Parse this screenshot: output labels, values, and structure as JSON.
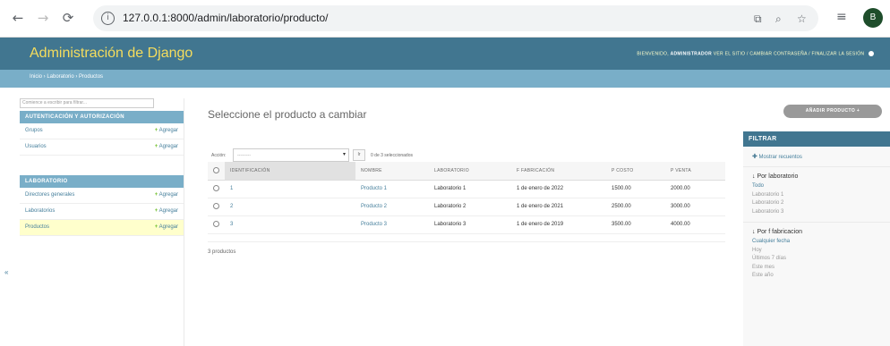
{
  "browser": {
    "back": "←",
    "forward": "→",
    "reload": "⟳",
    "url": "127.0.0.1:8000/admin/laboratorio/producto/",
    "profile_initial": "B"
  },
  "header": {
    "brand": "Administración de Django",
    "welcome": "BIENVENIDO,",
    "user": "ADMINISTRADOR",
    "links": "VER EL SITIO / CAMBIAR CONTRASEÑA / FINALIZAR LA SESIÓN"
  },
  "breadcrumbs": "Inicio › Laboratorio › Productos",
  "sidebar": {
    "filter_placeholder": "Comience a escribir para filtrar...",
    "apps": [
      {
        "caption": "AUTENTICACIÓN Y AUTORIZACIÓN",
        "models": [
          {
            "name": "Grupos",
            "add": "Agregar"
          },
          {
            "name": "Usuarios",
            "add": "Agregar"
          }
        ]
      },
      {
        "caption": "LABORATORIO",
        "models": [
          {
            "name": "Directores generales",
            "add": "Agregar"
          },
          {
            "name": "Laboratorios",
            "add": "Agregar"
          },
          {
            "name": "Productos",
            "add": "Agregar"
          }
        ]
      }
    ],
    "collapse": "«"
  },
  "main": {
    "title": "Seleccione el producto a cambiar",
    "add_button": "AÑADIR PRODUCTO +",
    "action_label": "Acción:",
    "action_select": "---------",
    "go_button": "Ir",
    "selected_count": "0 de 3 seleccionados",
    "columns": [
      "IDENTIFICACIÓN",
      "NOMBRE",
      "LABORATORIO",
      "F FABRICACIÓN",
      "P COSTO",
      "P VENTA"
    ],
    "rows": [
      {
        "id": "1",
        "nombre": "Producto 1",
        "lab": "Laboratorio 1",
        "fecha": "1 de enero de 2022",
        "costo": "1500.00",
        "venta": "2000.00"
      },
      {
        "id": "2",
        "nombre": "Producto 2",
        "lab": "Laboratorio 2",
        "fecha": "1 de enero de 2021",
        "costo": "2500.00",
        "venta": "3000.00"
      },
      {
        "id": "3",
        "nombre": "Producto 3",
        "lab": "Laboratorio 3",
        "fecha": "1 de enero de 2019",
        "costo": "3500.00",
        "venta": "4000.00"
      }
    ],
    "paginator": "3 productos"
  },
  "filter": {
    "title": "FILTRAR",
    "show_counts": "Mostrar recuentos",
    "groups": [
      {
        "title": "↓ Por laboratorio",
        "items": [
          "Todo",
          "Laboratorio 1",
          "Laboratorio 2",
          "Laboratorio 3"
        ]
      },
      {
        "title": "↓ Por f fabricacion",
        "items": [
          "Cualquier fecha",
          "Hoy",
          "Últimos 7 días",
          "Este mes",
          "Este año"
        ]
      }
    ]
  }
}
